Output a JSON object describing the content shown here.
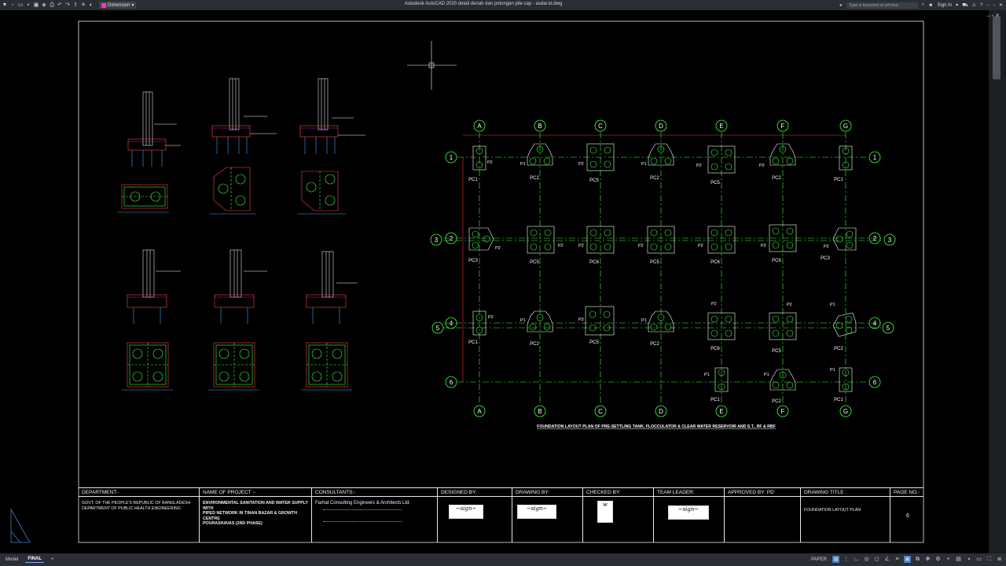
{
  "app": {
    "title": "Autodesk AutoCAD 2020   detail denah dan potongan pile cap - asdar.id.dwg",
    "layer_name": "Dimension",
    "search_placeholder": "Type a keyword or phrase",
    "sign_in": "Sign In",
    "quick_access_icons": [
      "new-icon",
      "open-icon",
      "save-icon",
      "save-as-icon",
      "web-icon",
      "plot-icon",
      "undo-icon",
      "redo-icon",
      "share-icon"
    ],
    "right_icons": [
      "cart-icon",
      "exchange-icon",
      "help-icon"
    ]
  },
  "drawing": {
    "grid_columns": [
      "A",
      "B",
      "C",
      "D",
      "E",
      "F",
      "G"
    ],
    "grid_rows_left": [
      "1",
      "2",
      "4",
      "6"
    ],
    "grid_rows_outer": [
      "3",
      "5"
    ],
    "grid_rows_right": [
      "1",
      "2",
      "4",
      "6"
    ],
    "caption": "FOUNDATION LAYOUT PLAN OF PRE-SETTLING TANK, FLOCCULATOR & CLEAR WATER RESERVOIR AND S.T., RF & RBF",
    "pilecaps": {
      "row1": [
        "PC1",
        "PC2",
        "PC5",
        "PC2",
        "PC5",
        "PC2",
        "PC1"
      ],
      "row2": [
        "PC3",
        "PC5",
        "PC6",
        "PC5",
        "PC6",
        "PC6",
        "PC3"
      ],
      "row4": [
        "PC1",
        "PC2",
        "PC5",
        "PC2",
        "PC6",
        "PC5",
        "PC2"
      ],
      "row6": [
        "PC1",
        "PC2",
        "PC1"
      ]
    },
    "pile_labels": [
      "P1",
      "P2",
      "P3"
    ]
  },
  "title_block": {
    "department_hd": "DEPARTMENT:-",
    "department_body": [
      "GOVT. OF THE PEOPLE'S REPUBLIC OF BANGLADESH",
      "DEPARTMENT OF PUBLIC HEALTH ENGINEERING"
    ],
    "project_hd": "NAME OF PROJECT :-",
    "project_body": [
      "ENVIRONMENTAL SANITATION AND WATER SUPPLY WITH",
      "PIPED NETWORK IN TINAN BAZAR & GROWTH CENTRE",
      "POURASHAVAS (2ND PHASE)"
    ],
    "consultants_hd": "CONSULTANTS:-",
    "consultants_body": "Farhat Consulting Engineers & Architects Ltd.",
    "designed_hd": "DESIGNED BY:",
    "drawing_hd": "DRAWING BY:",
    "checked_hd": "CHECKED BY:",
    "leader_hd": "TEAM LEADER:",
    "approved_hd": "APPROVED BY: PD",
    "title_hd": "DRAWING TITLE :",
    "title_body": "FOUNDATION LAYOUT PLAN",
    "page_hd": "PAGE NO:-",
    "page_no": "6"
  },
  "status": {
    "tab_model": "Model",
    "tab_final": "FINAL",
    "add_tab": "+",
    "paper": "PAPER",
    "tool_icons": [
      "grid-icon",
      "snap-icon",
      "ortho-icon",
      "polar-icon",
      "osnap-icon",
      "otrack-icon",
      "lineweight-icon",
      "transparency-icon",
      "selection-cycle-icon",
      "annotation-scale-icon",
      "workspace-icon",
      "annotation-monitor-icon",
      "units-icon",
      "isolate-icon",
      "hardware-accel-icon",
      "clean-screen-icon",
      "customize-icon"
    ]
  }
}
